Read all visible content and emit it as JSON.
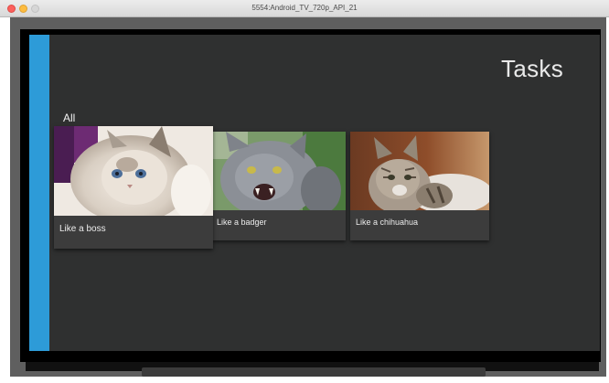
{
  "window": {
    "title": "5554:Android_TV_720p_API_21"
  },
  "screen": {
    "title": "Tasks",
    "row_header": "All",
    "cards": [
      {
        "label": "Like a boss",
        "image": "white-fluffy-cat-photo"
      },
      {
        "label": "Like a badger",
        "image": "grey-hissing-cat-photo"
      },
      {
        "label": "Like a chihuahua",
        "image": "tabby-cat-photo"
      }
    ]
  },
  "colors": {
    "screen_background": "#2f3030",
    "accent_strip": "#2d9bd8",
    "card_background": "#3c3c3c",
    "text": "#ececec"
  }
}
